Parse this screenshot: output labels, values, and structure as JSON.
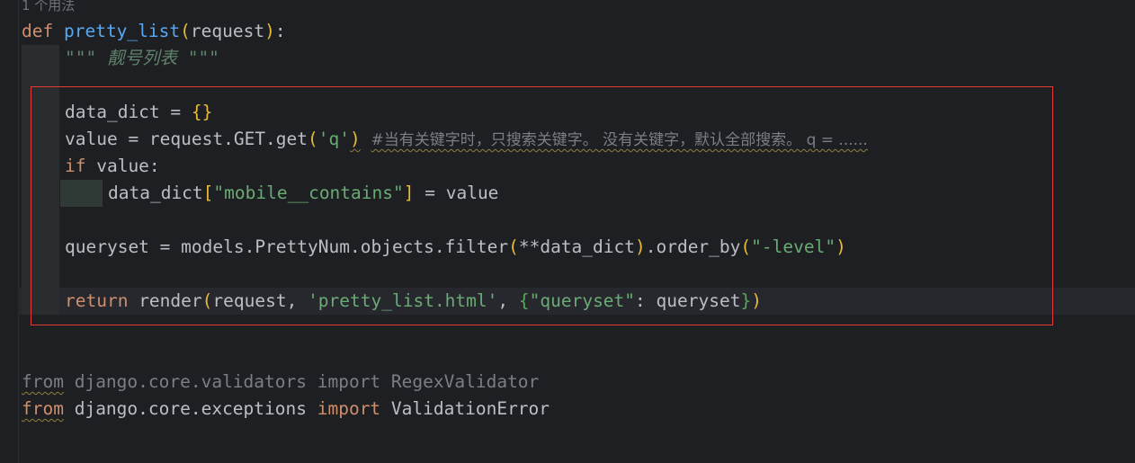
{
  "usage_hint": "1 个用法",
  "code": {
    "def_kw": "def",
    "func_name": "pretty_list",
    "paren_open": "(",
    "param": "request",
    "paren_close": ")",
    "colon": ":",
    "docstring": "\"\"\" 靓号列表 \"\"\"",
    "line_data_dict_var": "data_dict = ",
    "braces": "{}",
    "line_value_prefix": "value = request.GET.get",
    "open_p": "(",
    "q_str": "'q'",
    "close_p": ")",
    "comment": "#当有关键字时，只搜索关键字。 没有关键字，默认全部搜索。 q = ......",
    "if_kw": "if",
    "if_rest": " value:",
    "dd_prefix": "data_dict",
    "bracket_open": "[",
    "mobile_str": "\"mobile__contains\"",
    "bracket_close": "]",
    "dd_assign": " = value",
    "qs_prefix": "queryset = models.PrettyNum.objects.filter",
    "qs_open": "(",
    "qs_args": "**data_dict",
    "qs_close": ")",
    "order_by": ".order_by",
    "ob_open": "(",
    "level_str": "\"-level\"",
    "ob_close": ")",
    "return_kw": "return",
    "render_fn": " render",
    "r_open": "(",
    "render_args_a": "request, ",
    "template_str": "'pretty_list.html'",
    "comma": ", ",
    "dict_open": "{",
    "queryset_key": "\"queryset\"",
    "dict_rest": ": queryset",
    "dict_close": "}",
    "r_close": ")",
    "from1_kw": "from",
    "import1_module": " django.core.validators ",
    "import1_kw": "import",
    "import1_name": " RegexValidator",
    "from2_kw": "from",
    "import2_module": " django.core.exceptions ",
    "import2_kw": "import",
    "import2_name": " ValidationError"
  }
}
